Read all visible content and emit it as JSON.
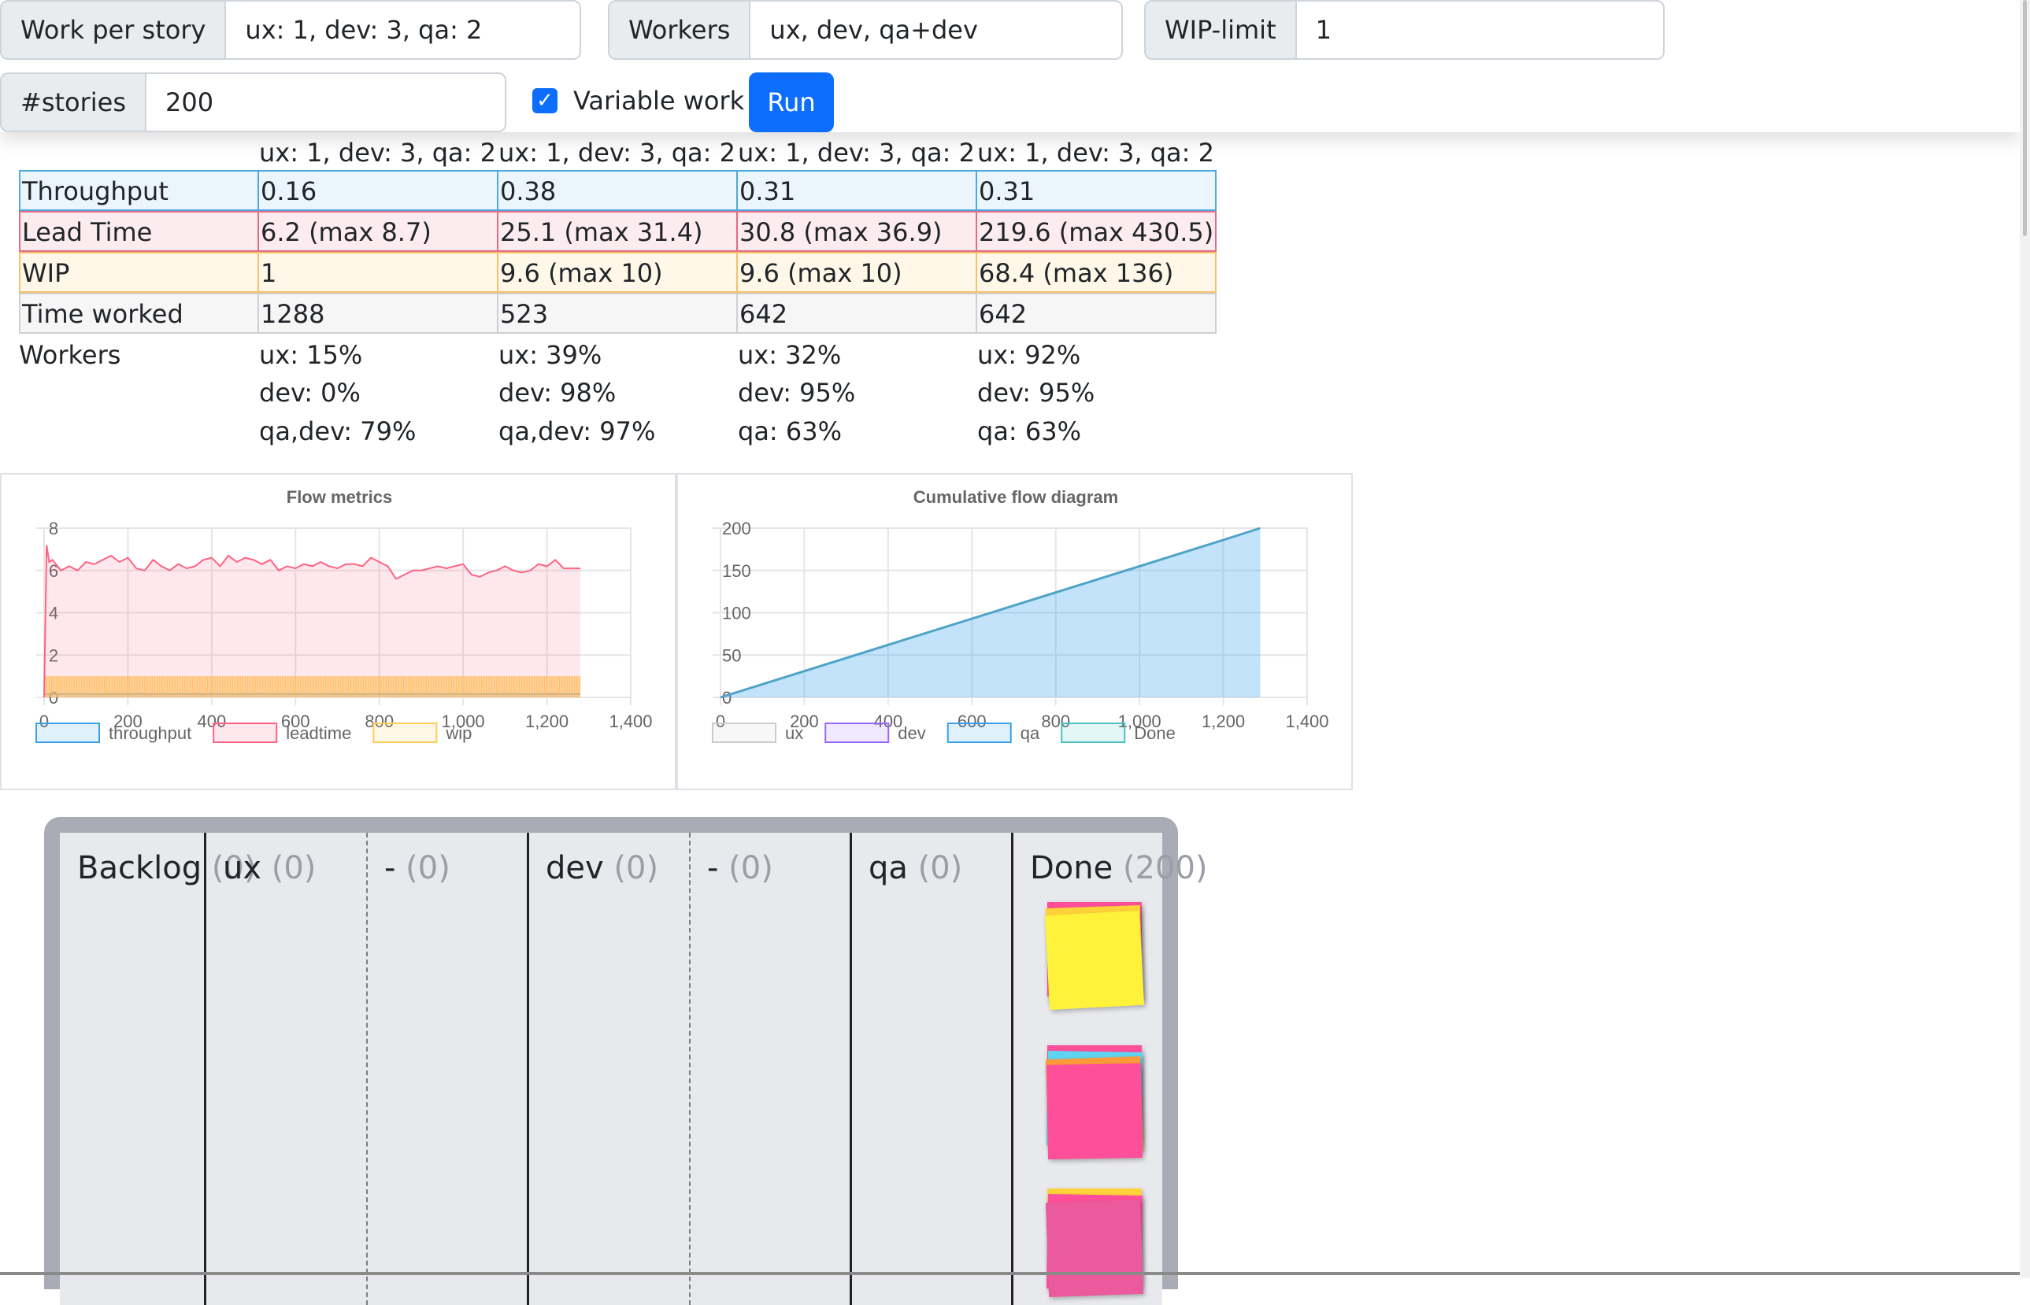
{
  "controls": {
    "work_label": "Work per story",
    "work_value": "ux: 1, dev: 3, qa: 2",
    "workers_label": "Workers",
    "workers_value": "ux, dev, qa+dev",
    "wip_label": "WIP-limit",
    "wip_value": "1",
    "stories_label": "#stories",
    "stories_value": "200",
    "variable_work_label": "Variable work",
    "variable_work_checked": true,
    "run_label": "Run"
  },
  "metrics": {
    "headers": [
      "ux: 1, dev: 3, qa: 2",
      "ux: 1, dev: 3, qa: 2",
      "ux: 1, dev: 3, qa: 2",
      "ux: 1, dev: 3, qa: 2"
    ],
    "rows": [
      {
        "label": "Throughput",
        "values": [
          "0.16",
          "0.38",
          "0.31",
          "0.31"
        ]
      },
      {
        "label": "Lead Time",
        "values": [
          "6.2 (max 8.7)",
          "25.1 (max 31.4)",
          "30.8 (max 36.9)",
          "219.6 (max 430.5)"
        ]
      },
      {
        "label": "WIP",
        "values": [
          "1",
          "9.6 (max 10)",
          "9.6 (max 10)",
          "68.4 (max 136)"
        ]
      },
      {
        "label": "Time worked",
        "values": [
          "1288",
          "523",
          "642",
          "642"
        ]
      }
    ],
    "workers_label": "Workers",
    "workers": [
      [
        "ux: 15%",
        "dev: 0%",
        "qa,dev: 79%"
      ],
      [
        "ux: 39%",
        "dev: 98%",
        "qa,dev: 97%"
      ],
      [
        "ux: 32%",
        "dev: 95%",
        "qa: 63%"
      ],
      [
        "ux: 92%",
        "dev: 95%",
        "qa: 63%"
      ]
    ]
  },
  "chart_data": [
    {
      "type": "line",
      "title": "Flow metrics",
      "xlim": [
        0,
        1400
      ],
      "ylim": [
        0,
        8
      ],
      "x_ticks": [
        "0",
        "200",
        "400",
        "600",
        "800",
        "1,000",
        "1,200",
        "1,400"
      ],
      "y_ticks": [
        "0",
        "2",
        "4",
        "6",
        "8"
      ],
      "legend": [
        "throughput",
        "leadtime",
        "wip"
      ],
      "legend_position": "bottom",
      "colors": {
        "throughput": "#36a2eb",
        "leadtime": "#ff6384",
        "wip": "#ffcd56"
      },
      "series": [
        {
          "name": "leadtime",
          "x": [
            0,
            6,
            12,
            20,
            40,
            60,
            80,
            100,
            120,
            140,
            160,
            180,
            200,
            220,
            240,
            260,
            280,
            300,
            320,
            340,
            360,
            380,
            400,
            420,
            440,
            460,
            480,
            500,
            520,
            540,
            560,
            580,
            600,
            620,
            640,
            660,
            680,
            700,
            720,
            740,
            760,
            780,
            800,
            820,
            840,
            860,
            880,
            900,
            920,
            940,
            960,
            980,
            1000,
            1020,
            1040,
            1060,
            1080,
            1100,
            1120,
            1140,
            1160,
            1180,
            1200,
            1220,
            1240,
            1260,
            1280
          ],
          "y": [
            0,
            7.2,
            6.4,
            6.5,
            6.0,
            6.2,
            6.0,
            6.4,
            6.3,
            6.5,
            6.7,
            6.4,
            6.6,
            6.1,
            6.0,
            6.5,
            6.2,
            6.0,
            6.3,
            6.1,
            6.2,
            6.5,
            6.6,
            6.2,
            6.7,
            6.4,
            6.6,
            6.5,
            6.3,
            6.5,
            6.0,
            6.2,
            6.1,
            6.3,
            6.2,
            6.4,
            6.2,
            6.1,
            6.3,
            6.3,
            6.2,
            6.6,
            6.4,
            6.2,
            5.6,
            5.8,
            6.0,
            6.0,
            6.1,
            6.2,
            6.1,
            6.2,
            6.3,
            5.8,
            5.7,
            5.9,
            6.0,
            6.2,
            6.0,
            5.9,
            6.0,
            6.3,
            6.2,
            6.5,
            6.1,
            6.1,
            6.1
          ]
        },
        {
          "name": "wip",
          "x": [
            0,
            1280
          ],
          "y": [
            1,
            1
          ]
        },
        {
          "name": "throughput",
          "x": [
            0,
            1280
          ],
          "y": [
            0.16,
            0.16
          ]
        }
      ]
    },
    {
      "type": "area",
      "title": "Cumulative flow diagram",
      "xlim": [
        0,
        1400
      ],
      "ylim": [
        0,
        200
      ],
      "x_ticks": [
        "0",
        "200",
        "400",
        "600",
        "800",
        "1,000",
        "1,200",
        "1,400"
      ],
      "y_ticks": [
        "0",
        "50",
        "100",
        "150",
        "200"
      ],
      "legend": [
        "ux",
        "dev",
        "qa",
        "Done"
      ],
      "legend_position": "bottom",
      "colors": {
        "ux": "#c9cbcf",
        "dev": "#9966ff",
        "qa": "#36a2eb",
        "Done": "#4bc0c0"
      },
      "series": [
        {
          "name": "Done",
          "x": [
            0,
            200,
            400,
            600,
            800,
            1000,
            1200,
            1288
          ],
          "y": [
            0,
            31,
            62,
            93,
            124,
            155,
            186,
            200
          ]
        }
      ]
    }
  ],
  "board": {
    "columns": [
      {
        "name": "Backlog",
        "count": "(0)"
      },
      {
        "name": "ux",
        "count": "(0)"
      },
      {
        "name": "-",
        "count": "(0)"
      },
      {
        "name": "dev",
        "count": "(0)"
      },
      {
        "name": "-",
        "count": "(0)"
      },
      {
        "name": "qa",
        "count": "(0)"
      },
      {
        "name": "Done",
        "count": "(200)"
      }
    ],
    "note_colors": [
      "#ff4f9a",
      "#fff23a",
      "#ffd23a",
      "#5fd4f0",
      "#ff9a3a",
      "#ea5a9c"
    ]
  }
}
